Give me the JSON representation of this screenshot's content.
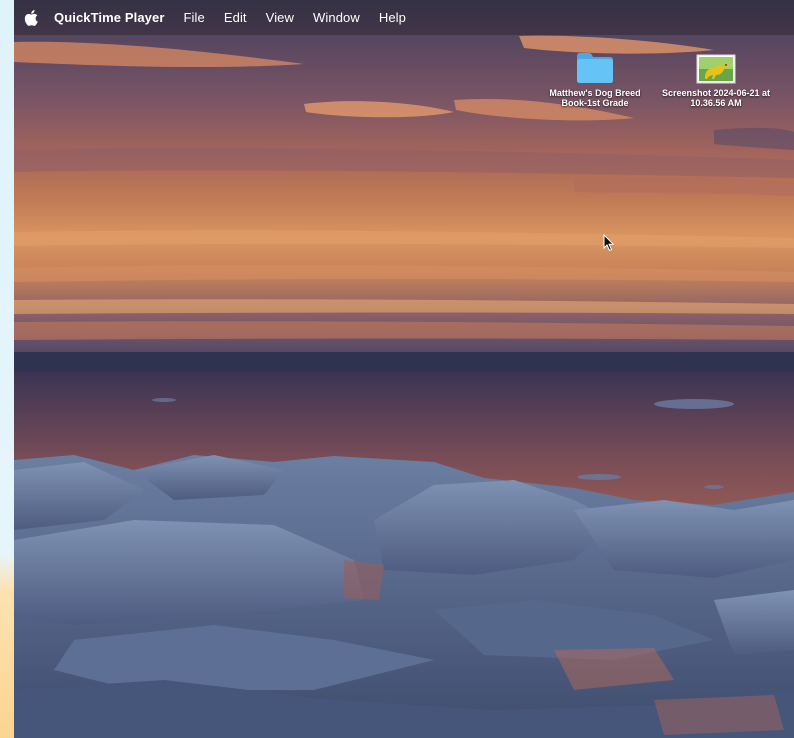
{
  "menubar": {
    "apple_icon": "apple-icon",
    "app_name": "QuickTime Player",
    "items": [
      "File",
      "Edit",
      "View",
      "Window",
      "Help"
    ]
  },
  "desktop": {
    "icons": [
      {
        "icon": "folder-icon",
        "label_lines": [
          "Matthew's Dog Breed",
          "Book-1st Grade"
        ]
      },
      {
        "icon": "image-file-icon",
        "label_lines": [
          "Screenshot 2024-06-21 at",
          "10.36.56 AM"
        ]
      }
    ]
  },
  "colors": {
    "folder_blue": "#5ebdf2",
    "menubar_text": "#ffffff"
  }
}
